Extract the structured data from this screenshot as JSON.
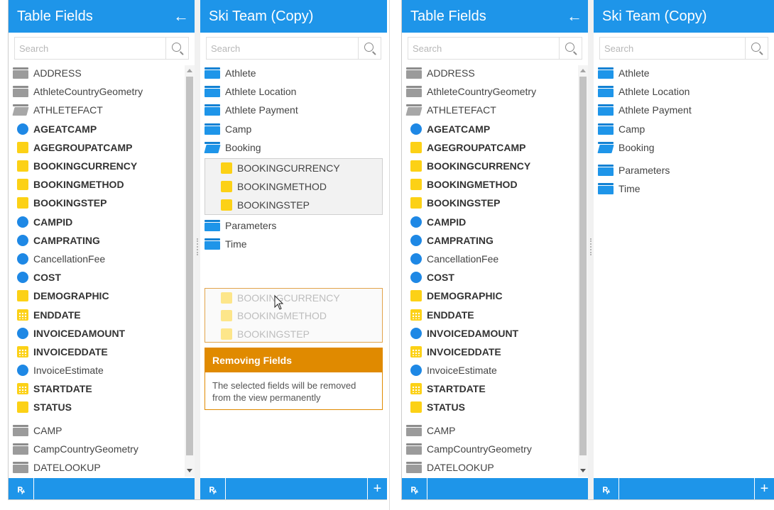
{
  "left": {
    "fields_panel": {
      "title": "Table Fields",
      "back_icon": "arrow-left-icon",
      "search_placeholder": "Search",
      "items": [
        {
          "type": "folder",
          "label": "ADDRESS"
        },
        {
          "type": "folder",
          "label": "AthleteCountryGeometry"
        },
        {
          "type": "folder-open",
          "label": "ATHLETEFACT"
        },
        {
          "type": "metric",
          "label": "AGEATCAMP",
          "bold": true
        },
        {
          "type": "dimension",
          "label": "AGEGROUPATCAMP",
          "bold": true
        },
        {
          "type": "dimension",
          "label": "BOOKINGCURRENCY",
          "bold": true
        },
        {
          "type": "dimension",
          "label": "BOOKINGMETHOD",
          "bold": true
        },
        {
          "type": "dimension",
          "label": "BOOKINGSTEP",
          "bold": true
        },
        {
          "type": "metric",
          "label": "CAMPID",
          "bold": true
        },
        {
          "type": "metric",
          "label": "CAMPRATING",
          "bold": true
        },
        {
          "type": "metric",
          "label": "CancellationFee",
          "bold": false
        },
        {
          "type": "metric",
          "label": "COST",
          "bold": true
        },
        {
          "type": "dimension",
          "label": "DEMOGRAPHIC",
          "bold": true
        },
        {
          "type": "date",
          "label": "ENDDATE",
          "bold": true
        },
        {
          "type": "metric",
          "label": "INVOICEDAMOUNT",
          "bold": true
        },
        {
          "type": "date",
          "label": "INVOICEDDATE",
          "bold": true
        },
        {
          "type": "metric",
          "label": "InvoiceEstimate",
          "bold": false
        },
        {
          "type": "date",
          "label": "STARTDATE",
          "bold": true
        },
        {
          "type": "dimension",
          "label": "STATUS",
          "bold": true
        },
        {
          "type": "folder",
          "label": "CAMP"
        },
        {
          "type": "folder",
          "label": "CampCountryGeometry"
        },
        {
          "type": "folder",
          "label": "DATELOOKUP"
        }
      ],
      "footer_icon": "ꝶ"
    },
    "view_panel": {
      "title": "Ski Team (Copy)",
      "search_placeholder": "Search",
      "folders_top": [
        "Athlete",
        "Athlete Location",
        "Athlete Payment",
        "Camp"
      ],
      "booking_folder": "Booking",
      "booking_items": [
        "BOOKINGCURRENCY",
        "BOOKINGMETHOD",
        "BOOKINGSTEP"
      ],
      "folders_bottom": [
        "Parameters",
        "Time"
      ],
      "dragging_items": [
        "BOOKINGCURRENCY",
        "BOOKINGMETHOD",
        "BOOKINGSTEP"
      ],
      "removing_title": "Removing Fields",
      "removing_text": "The selected fields will be removed from the view permanently",
      "footer_icon": "ꝶ",
      "add_label": "+"
    }
  },
  "right": {
    "fields_panel": {
      "title": "Table Fields",
      "search_placeholder": "Search",
      "footer_icon": "ꝶ"
    },
    "view_panel": {
      "title": "Ski Team (Copy)",
      "search_placeholder": "Search",
      "folders": [
        "Athlete",
        "Athlete Location",
        "Athlete Payment",
        "Camp",
        "Booking",
        "Parameters",
        "Time"
      ],
      "footer_icon": "ꝶ",
      "add_label": "+"
    }
  },
  "colors": {
    "header_blue": "#1e95e9",
    "metric_blue": "#1e88e5",
    "dimension_yellow": "#fcd116",
    "warning_orange": "#e08a00"
  }
}
